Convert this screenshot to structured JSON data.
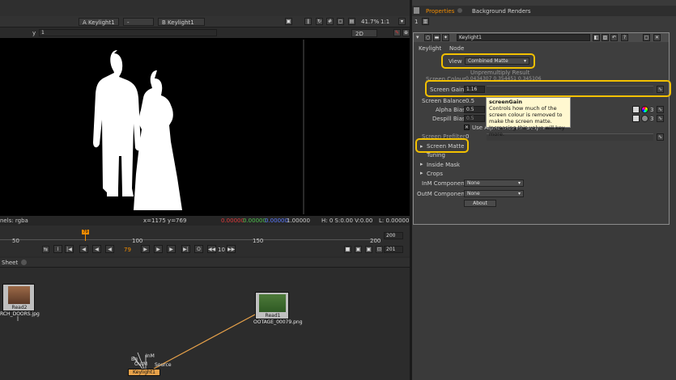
{
  "viewer": {
    "input_a_label": "A",
    "input_a_value": "Keylight1",
    "wipe_value": "-",
    "input_b_label": "B",
    "input_b_value": "Keylight1",
    "zoom": "41.7%",
    "ratio": "1:1",
    "y_label": "y",
    "frame_value": "1",
    "view_mode": "2D",
    "channels_text": "nels: rgba",
    "coords_text": "x=1175 y=769",
    "rgba_r": "0.00000",
    "rgba_g": "0.00000",
    "rgba_b": "0.00000",
    "rgba_a": "1.00000",
    "hsv_text": "H: 0 S:0.00 V:0.00",
    "l_text": "L: 0.00000"
  },
  "timeline": {
    "current_marker": "79",
    "ticks": [
      "50",
      "100",
      "150",
      "200"
    ],
    "current_frame": "79",
    "step": "10",
    "range_start": "200",
    "range_end": "201"
  },
  "nodegraph": {
    "tab_label": "Sheet",
    "nodes": {
      "read2_title": "Read2",
      "read2_file": "RCH_DOORS.jpg",
      "read1_title": "Read1",
      "read1_file": "OOTAGE_00079.png",
      "keylight_title": "Keylight1",
      "bg_label": "Bg",
      "inm_label": "InM",
      "outm_label": "OutM",
      "source_label": "Source"
    }
  },
  "properties": {
    "tab_properties": "Properties",
    "tab_background": "Background Renders",
    "node_name": "Keylight1",
    "subtab_keylight": "Keylight",
    "subtab_node": "Node",
    "view_label": "View",
    "view_value": "Combined Matte",
    "partial_row1": "Unpremultiply Result",
    "screen_colour_label": "Screen Colour",
    "screen_colour_values": "0.0434307   0.354451   0.345106",
    "screen_gain_label": "Screen Gain",
    "screen_gain_value": "1.16",
    "screen_balance_label": "Screen Balance",
    "screen_balance_value": "0.5",
    "alpha_bias_label": "Alpha Bias",
    "alpha_bias_value": "0.5",
    "despill_bias_label": "Despill Bias",
    "despill_bias_value": "0.5",
    "use_alpha_bias_label": "Use Alpha Bias for Despill",
    "screen_prefilter_label": "Screen Prefilter",
    "screen_prefilter_value": "0",
    "screen_matte_label": "Screen Matte",
    "tuning_label": "Tuning",
    "inside_mask_label": "Inside Mask",
    "crops_label": "Crops",
    "inm_component_label": "InM Component",
    "inm_component_value": "None",
    "outm_component_label": "OutM Component",
    "outm_component_value": "None",
    "about_label": "About",
    "channel_count": "3",
    "tooltip_title": "screenGain",
    "tooltip_body": "Controls how much of the screen colour is removed to make the screen matte. Increasing this value will key more."
  },
  "colors": {
    "highlight": "#f2c000",
    "tab_active": "#f28c00"
  }
}
